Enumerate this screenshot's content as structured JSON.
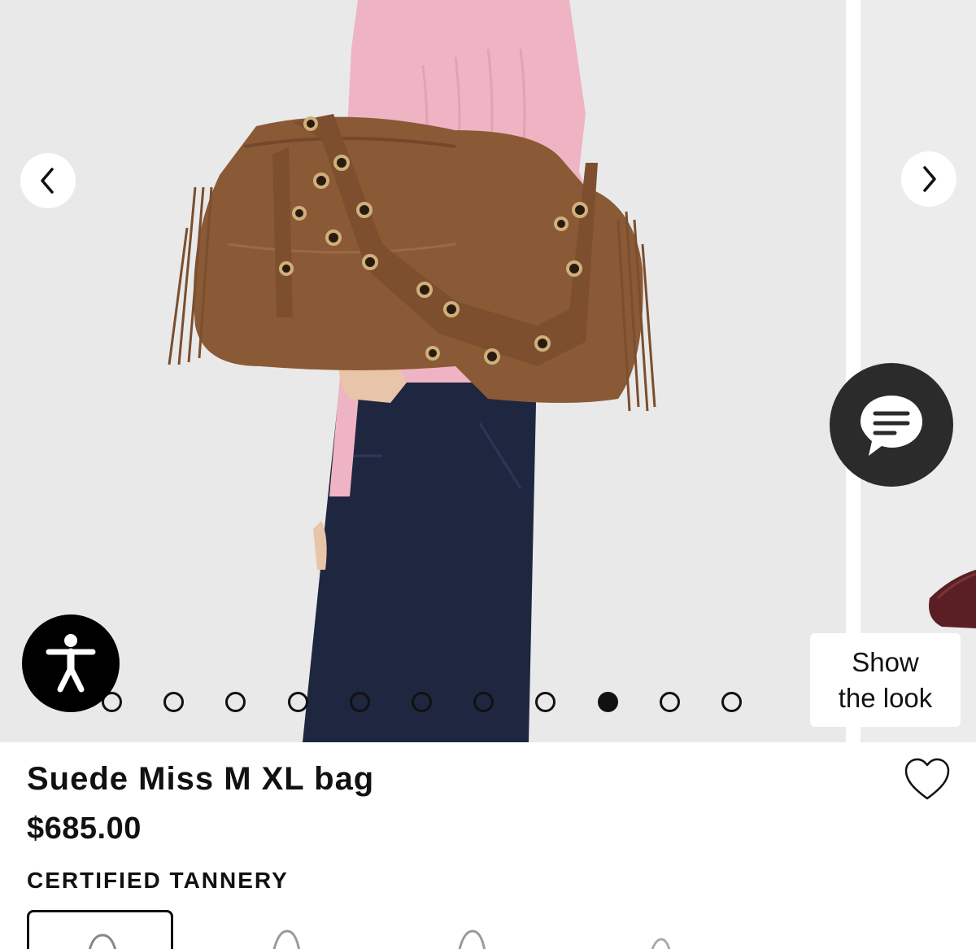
{
  "product": {
    "name": "Suede Miss M XL bag",
    "price": "$685.00",
    "badge": "CERTIFIED TANNERY"
  },
  "gallery": {
    "slide_count": 11,
    "active_slide_index": 8,
    "show_the_look_line1": "Show",
    "show_the_look_line2": "the look"
  },
  "icons": {
    "prev": "chevron-left-icon",
    "next": "chevron-right-icon",
    "chat": "chat-bubble-icon",
    "accessibility": "accessibility-icon",
    "wishlist": "heart-icon"
  },
  "colors": {
    "background": "#e9e9ea",
    "sweater": "#efb4c3",
    "suede": "#8a5a36",
    "denim": "#1f2740",
    "chat_button": "#2b2b2b"
  }
}
